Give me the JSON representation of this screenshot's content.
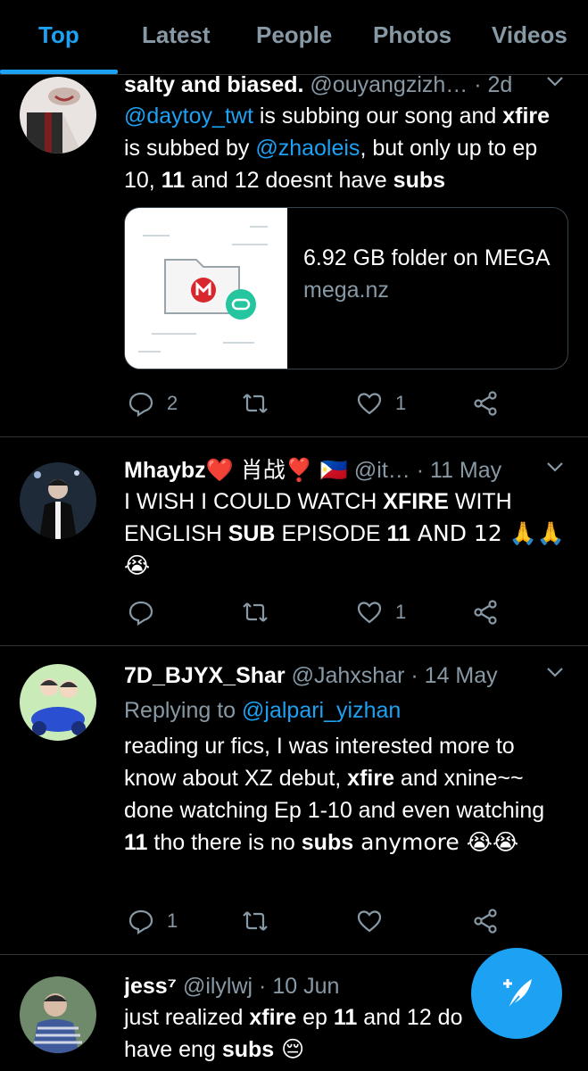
{
  "tabs": [
    "Top",
    "Latest",
    "People",
    "Photos",
    "Videos"
  ],
  "tweets": [
    {
      "name": "salty and biased.",
      "handle": "@ouyangzizh…",
      "time": "· 2d",
      "body": {
        "link1": "@daytoy_twt",
        "t1": " is subbing our song and ",
        "b1": "xfire",
        "t2": " is subbed by ",
        "link2": "@zhaoleis",
        "t3": ", but only up to ep 10, ",
        "b2": "11",
        "t4": " and 12 doesnt have ",
        "b3": "subs"
      },
      "card": {
        "title": "6.92 GB folder on MEGA",
        "domain": "mega.nz"
      },
      "replies": "2",
      "retweets": "",
      "likes": "1"
    },
    {
      "name": "Mhaybz",
      "name_extra": "❤️ 肖战❣️ 🇵🇭",
      "handle": "@it…",
      "time": "· 11 May",
      "body": {
        "t1": "I WISH I COULD WATCH ",
        "b1": "XFIRE",
        "t2": " WITH ENGLISH ",
        "b2": "SUB",
        "t3": " EPISODE ",
        "b3": "11",
        "t4": " AND 12 🙏🙏😭"
      },
      "replies": "",
      "retweets": "",
      "likes": "1"
    },
    {
      "name": "7D_BJYX_Shar",
      "handle": "@Jahxshar",
      "time": "· 14 May",
      "replying_prefix": "Replying to ",
      "replying_to": "@jalpari_yizhan",
      "body": {
        "t1": "reading ur fics, I was interested more to know about XZ debut, ",
        "b1": "xfire",
        "t2": " and xnine~~ done watching Ep 1-10 and even watching ",
        "b2": "11",
        "t3": " tho there is no ",
        "b3": "subs",
        "t4": " anymore 😭😭"
      },
      "replies": "1",
      "retweets": "",
      "likes": ""
    },
    {
      "name": "jess⁷",
      "handle": "@ilylwj",
      "time": "· 10 Jun",
      "body": {
        "t1": "just realized ",
        "b1": "xfire",
        "t2": " ep ",
        "b2": "11",
        "t3": " and 12 do",
        "t4": "have eng ",
        "b3": "subs",
        "t5": " 😔"
      }
    }
  ],
  "colors": {
    "accent": "#1da1f2",
    "secondary": "#8899a6",
    "divider": "#2f3336"
  },
  "icons": [
    "reply-icon",
    "retweet-icon",
    "like-icon",
    "share-icon",
    "chevron-down-icon",
    "compose-icon",
    "mega-folder-icon"
  ]
}
